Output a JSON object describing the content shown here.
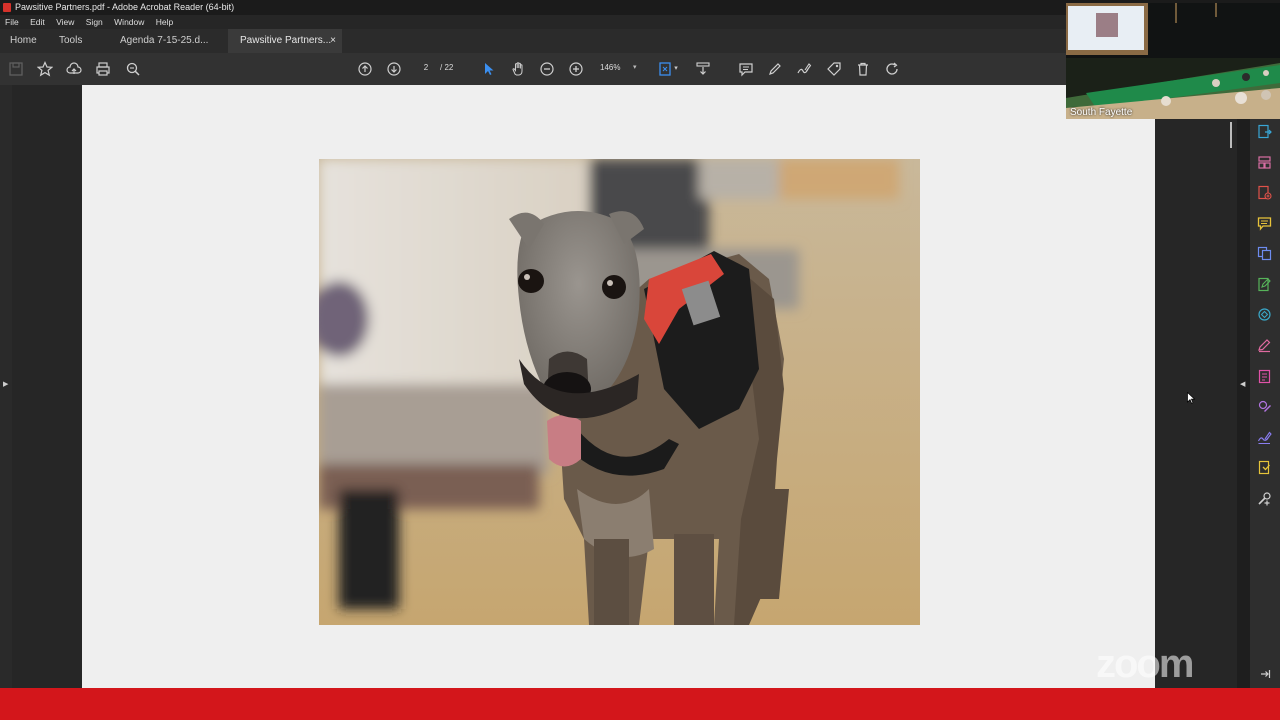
{
  "window": {
    "title": "Pawsitive Partners.pdf - Adobe Acrobat Reader (64-bit)"
  },
  "menu": [
    "File",
    "Edit",
    "View",
    "Sign",
    "Window",
    "Help"
  ],
  "tabs": {
    "home": "Home",
    "tools": "Tools",
    "doc1": "Agenda 7-15-25.d...",
    "doc2": "Pawsitive Partners...",
    "close": "×"
  },
  "toolbar": {
    "page_current": "2",
    "page_total": "/ 22",
    "zoom": "146%"
  },
  "video": {
    "label": "South Fayette"
  },
  "watermark": {
    "text": "zoom"
  },
  "colors": {
    "bottom_bar": "#d3161b",
    "accent_blue": "#3b8ff0"
  },
  "icons": {
    "right_rail": [
      "export-pdf-icon",
      "organize-pages-icon",
      "create-pdf-icon",
      "comment-icon",
      "scan-icon",
      "edit-pdf-icon",
      "protect-icon",
      "fill-sign-icon",
      "prepare-form-icon",
      "send-for-signature-icon",
      "request-signature-icon",
      "stamp-icon",
      "more-tools-icon"
    ]
  }
}
